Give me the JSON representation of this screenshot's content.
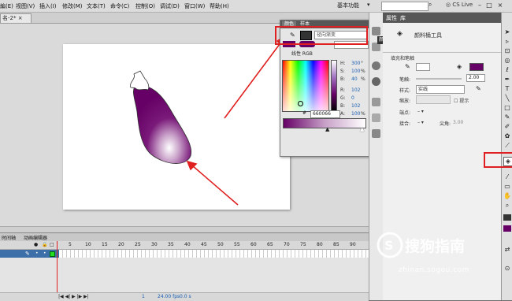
{
  "menu": {
    "items": [
      "編(E)",
      "视图(V)",
      "插入(I)",
      "修改(M)",
      "文本(T)",
      "命令(C)",
      "控制(O)",
      "调试(D)",
      "窗口(W)",
      "帮助(H)"
    ],
    "workspace": "基本功能",
    "cslive": "CS Live"
  },
  "doc_tab": "名-2*",
  "color_panel": {
    "tabs": [
      "颜色",
      "样本"
    ],
    "type": "径向渐变",
    "linear_rgb": "线性 RGB",
    "hsb": [
      {
        "label": "H:",
        "value": "300",
        "unit": "°"
      },
      {
        "label": "S:",
        "value": "100",
        "unit": "%"
      },
      {
        "label": "B:",
        "value": "40",
        "unit": "%"
      },
      {
        "label": "R:",
        "value": "102",
        "unit": ""
      },
      {
        "label": "G:",
        "value": "0",
        "unit": ""
      },
      {
        "label": "B:",
        "value": "102",
        "unit": ""
      },
      {
        "label": "A:",
        "value": "100",
        "unit": "%"
      }
    ],
    "hex": "660066",
    "colors": {
      "fill": "#660066",
      "stroke": "#333333"
    }
  },
  "properties": {
    "tabs": [
      "属性",
      "库"
    ],
    "tool_name": "颜料桶工具",
    "fill_tooltip": "颜色",
    "section": "填充和笔触",
    "stroke_label": "笔触:",
    "stroke_value": "2.00",
    "style_label": "样式:",
    "style_value": "实线",
    "scale_label": "缩放:",
    "hint_label": "提示",
    "cap_label": "端点:",
    "join_label": "接合:",
    "miter_label": "尖角:",
    "miter_value": "3.00"
  },
  "timeline": {
    "tabs": [
      "时间轴",
      "动画编辑器"
    ],
    "frame_numbers": [
      "5",
      "10",
      "15",
      "20",
      "25",
      "30",
      "35",
      "40",
      "45",
      "50",
      "55",
      "60",
      "65",
      "70",
      "75",
      "80",
      "85",
      "90"
    ],
    "footer": {
      "frame": "1",
      "fps": "24.00 fps",
      "time": "0.0 s"
    }
  },
  "watermark": {
    "text": "搜狗指南",
    "url": "zhinan.sogou.com"
  }
}
